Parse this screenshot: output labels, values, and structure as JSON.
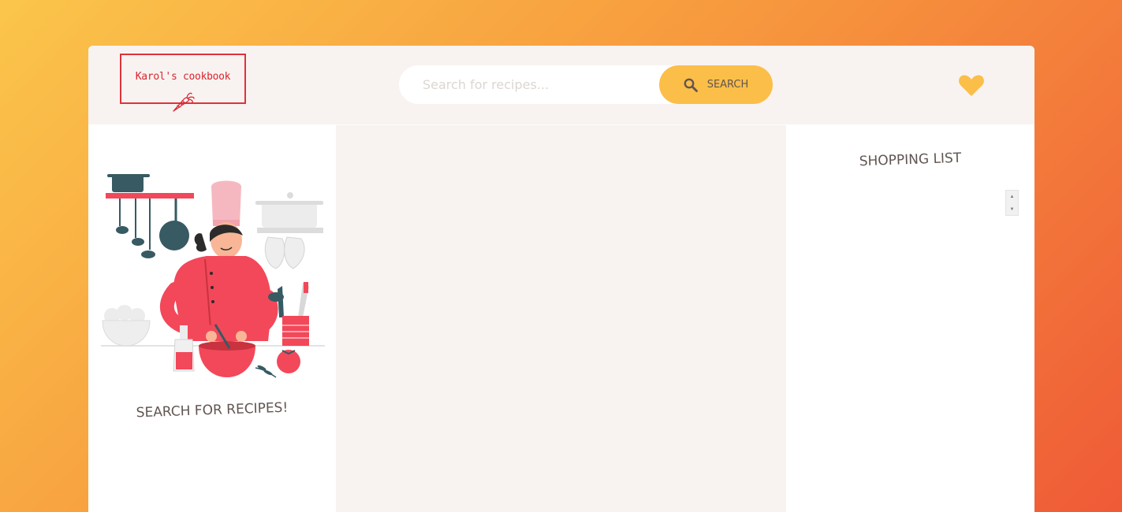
{
  "header": {
    "logo_text": "Karol's cookbook",
    "search": {
      "placeholder": "Search for recipes...",
      "value": ""
    },
    "search_button_label": "SEARCH",
    "bookmarks_icon": "heart-icon"
  },
  "left_panel": {
    "illustration": "chef-illustration",
    "message": "SEARCH FOR RECIPES!"
  },
  "recipe_panel": {},
  "shopping_list": {
    "title": "SHOPPING LIST",
    "items": []
  },
  "colors": {
    "accent": "#fbbe48",
    "brand_red": "#e0323b",
    "text": "#615551",
    "panel_bg": "#f8f3f1"
  }
}
